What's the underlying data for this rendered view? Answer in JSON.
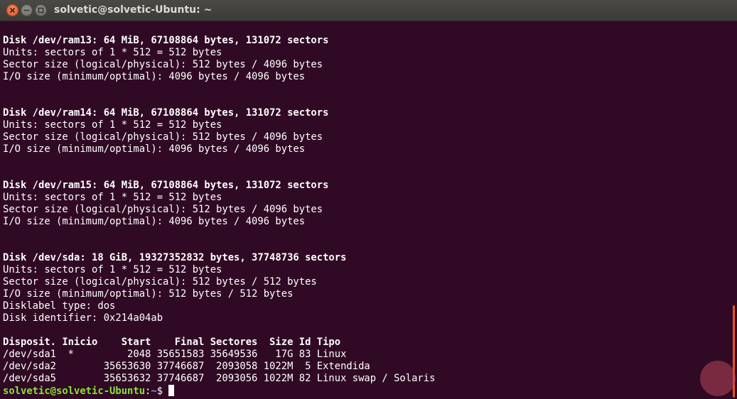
{
  "window": {
    "title": "solvetic@solvetic-Ubuntu: ~"
  },
  "terminal": {
    "lines": [
      {
        "text": "Disk /dev/ram13: 64 MiB, 67108864 bytes, 131072 sectors",
        "bold": true
      },
      {
        "text": "Units: sectors of 1 * 512 = 512 bytes",
        "bold": false
      },
      {
        "text": "Sector size (logical/physical): 512 bytes / 4096 bytes",
        "bold": false
      },
      {
        "text": "I/O size (minimum/optimal): 4096 bytes / 4096 bytes",
        "bold": false
      },
      {
        "text": "",
        "bold": false
      },
      {
        "text": "",
        "bold": false
      },
      {
        "text": "Disk /dev/ram14: 64 MiB, 67108864 bytes, 131072 sectors",
        "bold": true
      },
      {
        "text": "Units: sectors of 1 * 512 = 512 bytes",
        "bold": false
      },
      {
        "text": "Sector size (logical/physical): 512 bytes / 4096 bytes",
        "bold": false
      },
      {
        "text": "I/O size (minimum/optimal): 4096 bytes / 4096 bytes",
        "bold": false
      },
      {
        "text": "",
        "bold": false
      },
      {
        "text": "",
        "bold": false
      },
      {
        "text": "Disk /dev/ram15: 64 MiB, 67108864 bytes, 131072 sectors",
        "bold": true
      },
      {
        "text": "Units: sectors of 1 * 512 = 512 bytes",
        "bold": false
      },
      {
        "text": "Sector size (logical/physical): 512 bytes / 4096 bytes",
        "bold": false
      },
      {
        "text": "I/O size (minimum/optimal): 4096 bytes / 4096 bytes",
        "bold": false
      },
      {
        "text": "",
        "bold": false
      },
      {
        "text": "",
        "bold": false
      },
      {
        "text": "Disk /dev/sda: 18 GiB, 19327352832 bytes, 37748736 sectors",
        "bold": true
      },
      {
        "text": "Units: sectors of 1 * 512 = 512 bytes",
        "bold": false
      },
      {
        "text": "Sector size (logical/physical): 512 bytes / 512 bytes",
        "bold": false
      },
      {
        "text": "I/O size (minimum/optimal): 512 bytes / 512 bytes",
        "bold": false
      },
      {
        "text": "Disklabel type: dos",
        "bold": false
      },
      {
        "text": "Disk identifier: 0x214a04ab",
        "bold": false
      },
      {
        "text": "",
        "bold": false
      },
      {
        "text": "Disposit. Inicio    Start    Final Sectores  Size Id Tipo",
        "bold": true
      },
      {
        "text": "/dev/sda1  *         2048 35651583 35649536   17G 83 Linux",
        "bold": false
      },
      {
        "text": "/dev/sda2        35653630 37746687  2093058 1022M  5 Extendida",
        "bold": false
      },
      {
        "text": "/dev/sda5        35653632 37746687  2093056 1022M 82 Linux swap / Solaris",
        "bold": false
      }
    ],
    "prompt": {
      "user_host": "solvetic@solvetic-Ubuntu",
      "separator": ":",
      "path": "~",
      "symbol": "$ "
    }
  },
  "colors": {
    "background": "#300a24",
    "text": "#ffffff",
    "prompt_user": "#8ae234",
    "prompt_path": "#729fcf",
    "accent": "#e9541f"
  }
}
